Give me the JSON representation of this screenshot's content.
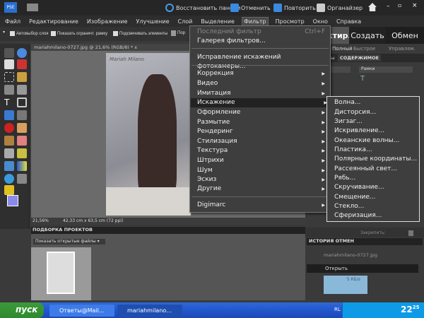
{
  "titlebar": {
    "logo": "PSE",
    "restore_panels": "Восстановить панели",
    "undo": "Отменить",
    "redo": "Повторить",
    "organizer": "Органайзер"
  },
  "menubar": [
    "Файл",
    "Редактирование",
    "Изображение",
    "Улучшение",
    "Слой",
    "Выделение",
    "Фильтр",
    "Просмотр",
    "Окно",
    "Справка"
  ],
  "options": {
    "auto_select": "Автовыбор слоя",
    "show_bbox": "Показать ограничт. рамку",
    "highlight": "Подсвечивать элементы",
    "arrange": "Пор"
  },
  "document": {
    "tab": "mariahmilano-0727.jpg @ 21,6% (RGB/8) *",
    "close": "x",
    "zoom": "21,56%",
    "size": "42,33 cm x 63,5 cm (72 ppi)",
    "watermark": "Mariah Milano"
  },
  "project_bin": {
    "title": "ПОДБОРКА ПРОЕКТОВ",
    "select": "Показать открытые файлы"
  },
  "filter_menu": {
    "last_filter": "Последний фильтр",
    "last_filter_shortcut": "Ctrl+F",
    "gallery": "Галерея фильтров...",
    "lens": "Исправление искажений фотокамеры...",
    "items": [
      "Коррекция",
      "Видео",
      "Имитация",
      "Искажение",
      "Оформление",
      "Размытие",
      "Рендеринг",
      "Стилизация",
      "Текстура",
      "Штрихи",
      "Шум",
      "Эскиз",
      "Другие"
    ],
    "digimarc": "Digimarc"
  },
  "distort_submenu": [
    "Волна...",
    "Дисторсия...",
    "Зигзаг...",
    "Искривление...",
    "Океанские волны...",
    "Пластика...",
    "Полярные координаты...",
    "Рассеянный свет...",
    "Рябь...",
    "Скручивание...",
    "Смещение...",
    "Стекло...",
    "Сферизация..."
  ],
  "right_panel": {
    "tabs": [
      "Редактир.",
      "Создать",
      "Обмен"
    ],
    "subtabs": [
      "Полный",
      "Быстрое",
      "Управлям."
    ],
    "panel_tabs": [
      "...ы",
      "СОДЕРЖИМОЕ"
    ],
    "dropdown2": "Рамки",
    "lock": "Закрепить:",
    "history_title": "ИСТОРИЯ ОТМЕН",
    "history": [
      "mariahmilano-0727.jpg",
      "Открыть"
    ],
    "widget_size": "5 КБ/s"
  },
  "taskbar": {
    "start": "пуск",
    "tasks": [
      "Ответы@Mail...",
      "mariahmilano..."
    ],
    "lang": "RL",
    "time": "22",
    "time_min": "25"
  }
}
